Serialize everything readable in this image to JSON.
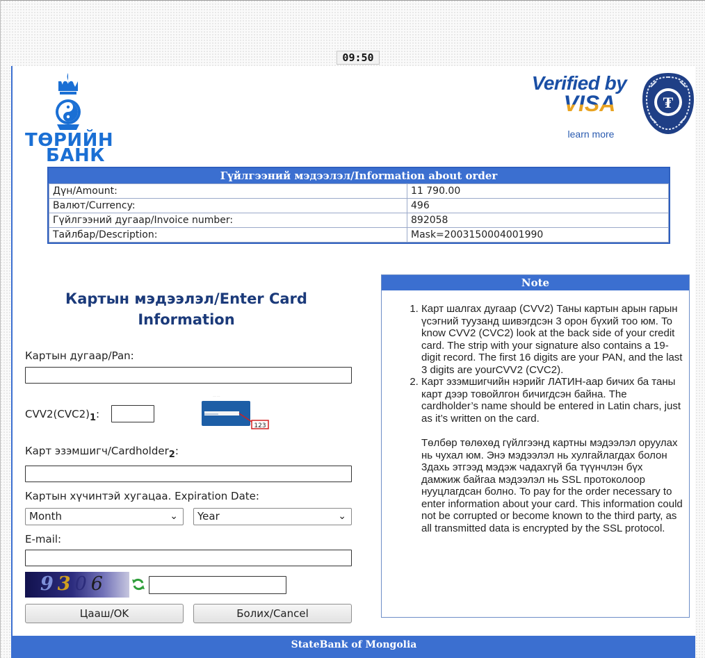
{
  "timer": "09:50",
  "bank_logo": {
    "line1": "ТӨРИЙН",
    "line2": "БАНК"
  },
  "verified": {
    "top": "Verified by",
    "brand": "VISA",
    "learn_more": "learn more"
  },
  "order": {
    "title": "Гүйлгээний мэдээлэл/Information about order",
    "rows": [
      {
        "label": "Дүн/Amount:",
        "value": "11 790.00"
      },
      {
        "label": "Валют/Currency:",
        "value": "496"
      },
      {
        "label": "Гүйлгээний дугаар/Invoice number:",
        "value": "892058"
      },
      {
        "label": "Тайлбар/Description:",
        "value": "Mask=2003150004001990"
      }
    ]
  },
  "card": {
    "title": "Картын мэдээлэл/Enter Card Information",
    "pan_label": "Картын дугаар/Pan:",
    "cvv_label": "CVV2(CVC2)",
    "cvv_sub": "1",
    "cvv_colon": ":",
    "holder_label": "Карт эзэмшигч/Cardholder",
    "holder_sub": "2",
    "holder_colon": ":",
    "expiry_label": "Картын хүчинтэй хугацаа. Expiration Date:",
    "month_value": "Month",
    "year_value": "Year",
    "email_label": "E-mail:",
    "card_image_text": "123",
    "captcha_text": "9306",
    "ok_label": "Цааш/OK",
    "cancel_label": "Болих/Cancel"
  },
  "note": {
    "title": "Note",
    "items": [
      "Карт шалгах дугаар (CVV2) Таны картын арын гарын үсэгний туузанд шивэгдсэн 3 орон бүхий тоо юм. To know CVV2 (CVC2) look at the back side of your credit card. The strip with your signature also contains a 19-digit record. The first 16 digits are your PAN, and the last 3 digits are yourCVV2 (CVC2).",
      "Карт эзэмшигчийн нэрийг ЛАТИН-аар бичих ба таны карт дээр товойлгон бичигдсэн байна. The cardholder’s name should be entered in Latin chars, just as it’s written on the card."
    ],
    "paragraph": "Төлбөр төлөхөд гүйлгээнд картны мэдээлэл оруулах нь чухал юм. Энэ мэдээлэл нь хулгайлагдах болон 3дахь этгээд мэдэж чадахгүй ба түүнчлэн бүх дамжиж байгаа мэдээлэл нь SSL протоколоор нууцлагдсан болно. To pay for the order necessary to enter information about your card. This information could not be corrupted or become known to the third party, as all transmitted data is encrypted by the SSL protocol."
  },
  "footer": "StateBank of Mongolia"
}
